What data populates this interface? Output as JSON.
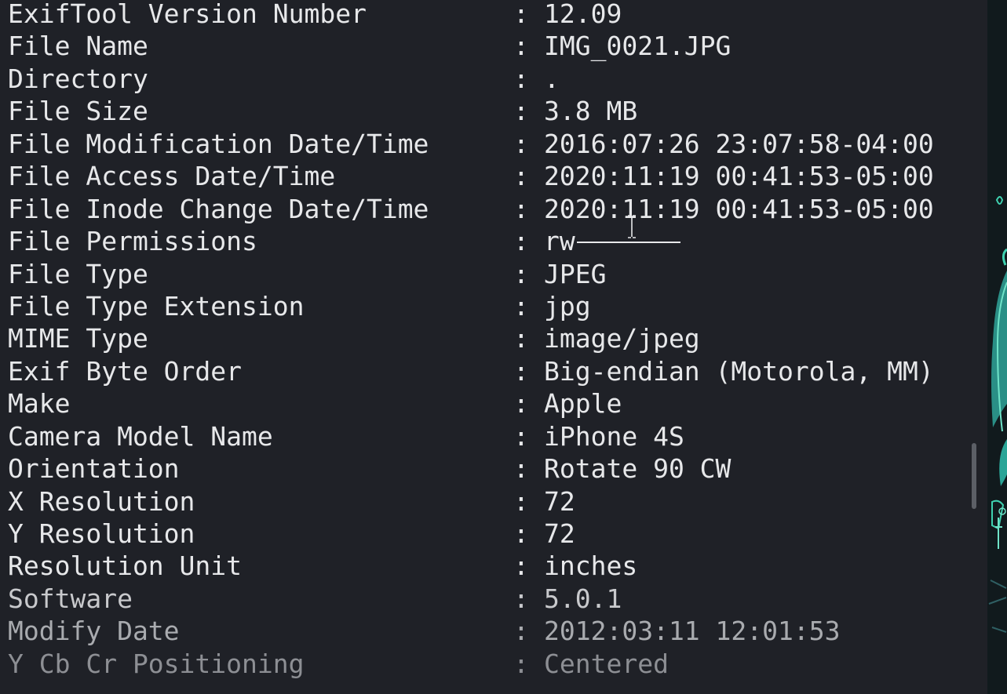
{
  "terminal": {
    "rows": [
      {
        "tag": "ExifTool Version Number",
        "sep": ":",
        "value": "12.09"
      },
      {
        "tag": "File Name",
        "sep": ":",
        "value": "IMG_0021.JPG"
      },
      {
        "tag": "Directory",
        "sep": ":",
        "value": "."
      },
      {
        "tag": "File Size",
        "sep": ":",
        "value": "3.8 MB"
      },
      {
        "tag": "File Modification Date/Time",
        "sep": ":",
        "value": "2016:07:26 23:07:58-04:00"
      },
      {
        "tag": "File Access Date/Time",
        "sep": ":",
        "value": "2020:11:19 00:41:53-05:00"
      },
      {
        "tag": "File Inode Change Date/Time",
        "sep": ":",
        "value": "2020:11:19 00:41:53-05:00"
      },
      {
        "tag": "File Permissions",
        "sep": ":",
        "value": "rw"
      },
      {
        "tag": "File Type",
        "sep": ":",
        "value": "JPEG"
      },
      {
        "tag": "File Type Extension",
        "sep": ":",
        "value": "jpg"
      },
      {
        "tag": "MIME Type",
        "sep": ":",
        "value": "image/jpeg"
      },
      {
        "tag": "Exif Byte Order",
        "sep": ":",
        "value": "Big-endian (Motorola, MM)"
      },
      {
        "tag": "Make",
        "sep": ":",
        "value": "Apple"
      },
      {
        "tag": "Camera Model Name",
        "sep": ":",
        "value": "iPhone 4S"
      },
      {
        "tag": "Orientation",
        "sep": ":",
        "value": "Rotate 90 CW"
      },
      {
        "tag": "X Resolution",
        "sep": ":",
        "value": "72"
      },
      {
        "tag": "Y Resolution",
        "sep": ":",
        "value": "72"
      },
      {
        "tag": "Resolution Unit",
        "sep": ":",
        "value": "inches"
      },
      {
        "tag": "Software",
        "sep": ":",
        "value": "5.0.1"
      },
      {
        "tag": "Modify Date",
        "sep": ":",
        "value": "2012:03:11 12:01:53"
      },
      {
        "tag": "Y Cb Cr Positioning",
        "sep": ":",
        "value": "Centered"
      }
    ]
  },
  "colors": {
    "background": "#1f2127",
    "text": "#e7e8ea",
    "scrollbar_thumb": "#5c5f66",
    "wallpaper_accent": "#3fd1b0"
  },
  "icons": {
    "cursor": "i-beam-cursor-icon"
  }
}
